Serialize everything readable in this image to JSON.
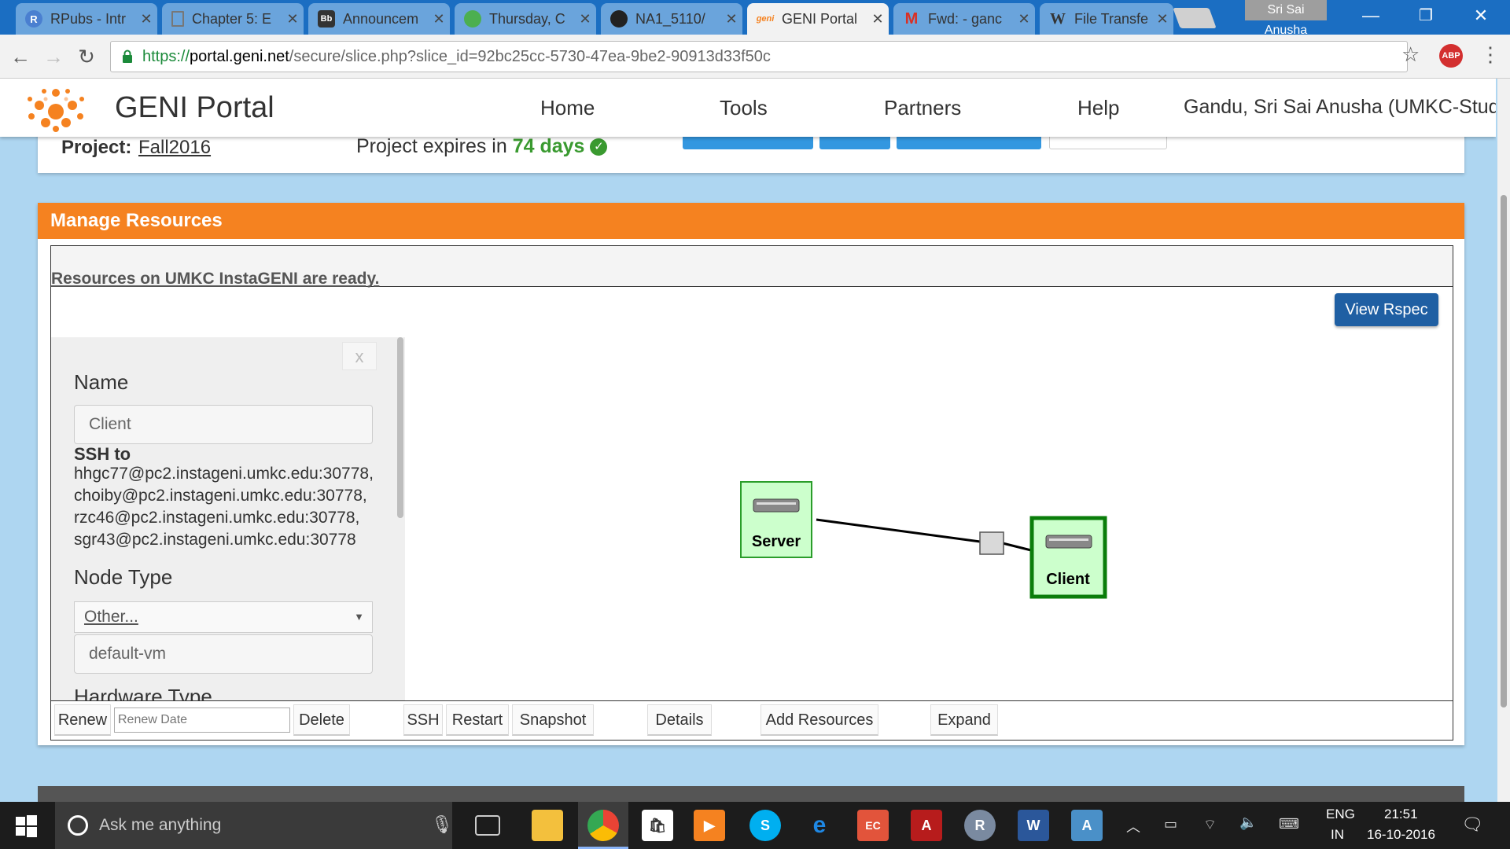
{
  "browser": {
    "tabs": [
      {
        "title": "RPubs - Intr",
        "icon": "R",
        "color": "#4a7fd0"
      },
      {
        "title": "Chapter 5: E",
        "icon": "doc",
        "color": "#888888"
      },
      {
        "title": "Announcem",
        "icon": "Bb",
        "color": "#333333"
      },
      {
        "title": "Thursday, C",
        "icon": "leaf",
        "color": "#4caf50"
      },
      {
        "title": "NA1_5110/",
        "icon": "github",
        "color": "#222222"
      },
      {
        "title": "GENI Portal",
        "icon": "geni",
        "color": "#f58220"
      },
      {
        "title": "Fwd: - ganc",
        "icon": "M",
        "color": "#d93025"
      },
      {
        "title": "File Transfe",
        "icon": "W",
        "color": "#333333"
      }
    ],
    "active_tab": 5,
    "profile_name": "Sri Sai Anusha",
    "url_scheme": "https://",
    "url_host": "portal.geni.net",
    "url_path": "/secure/slice.php?slice_id=92bc25cc-5730-47ea-9be2-90913d33f50c",
    "abp_label": "ABP"
  },
  "header": {
    "title": "GENI Portal",
    "nav": [
      "Home",
      "Tools",
      "Partners",
      "Help"
    ],
    "user": "Gandu, Sri Sai Anusha (UMKC-Student)"
  },
  "project": {
    "label": "Project:",
    "name": "Fall2016",
    "expires_prefix": "Project expires in ",
    "expires_value": "74 days",
    "check": "✓"
  },
  "manage": {
    "title": "Manage Resources",
    "status": "Resources on UMKC InstaGENI are ready.",
    "view_rspec": "View Rspec",
    "close": "x",
    "name_label": "Name",
    "name_value": "Client",
    "ssh_label": "SSH to",
    "ssh_lines": [
      "hhgc77@pc2.instageni.umkc.edu:30778,",
      "choiby@pc2.instageni.umkc.edu:30778,",
      "rzc46@pc2.instageni.umkc.edu:30778,",
      "sgr43@pc2.instageni.umkc.edu:30778"
    ],
    "node_type_label": "Node Type",
    "node_type_selected": "Other...",
    "node_type_value": "default-vm",
    "hardware_type_label": "Hardware Type",
    "nodes": [
      "Server",
      "Client"
    ],
    "toolbar": {
      "renew": "Renew",
      "renew_placeholder": "Renew Date",
      "delete": "Delete",
      "ssh": "SSH",
      "restart": "Restart",
      "snapshot": "Snapshot",
      "details": "Details",
      "add_resources": "Add Resources",
      "expand": "Expand"
    }
  },
  "taskbar": {
    "search_placeholder": "Ask me anything",
    "lang_top": "ENG",
    "lang_bottom": "IN",
    "time": "21:51",
    "date": "16-10-2016"
  }
}
